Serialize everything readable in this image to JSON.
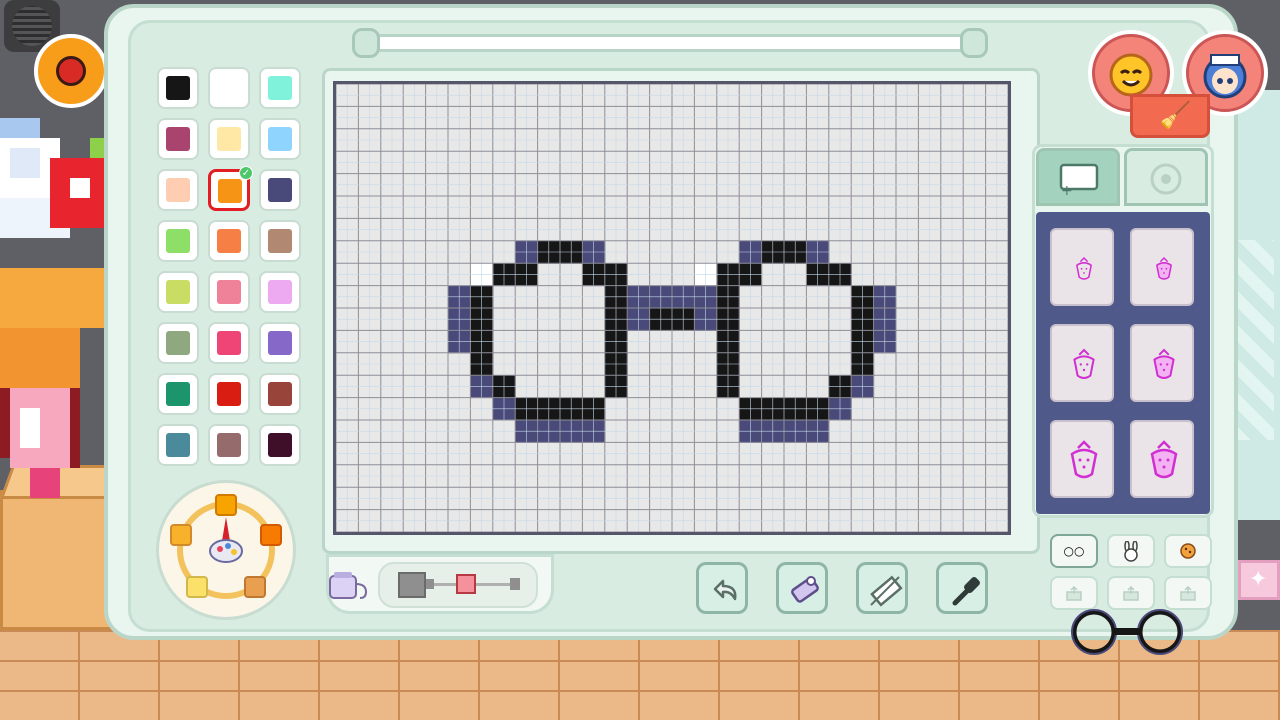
{
  "palette": {
    "colors": [
      "#161616",
      "#ffffff",
      "#80f2dc",
      "#a9446e",
      "#ffe8a6",
      "#8fd3ff",
      "#ffcdb2",
      "#f59415",
      "#49497a",
      "#8edf68",
      "#f57f45",
      "#b18872",
      "#c9dc63",
      "#ef8199",
      "#edaaf0",
      "#90a87f",
      "#ef4476",
      "#8568c8",
      "#1c946c",
      "#d91d12",
      "#98443a",
      "#4a8a9a",
      "#956b6b",
      "#3f0f29"
    ],
    "selected_index": 7
  },
  "colors": {
    "outline_dark": "#161616",
    "outline_shade": "#49497a",
    "canvas_bg": "#e8e8e8",
    "grid_minor": "#c5d8e8",
    "grid_major": "#8e8e98",
    "accent_red": "#e21e25",
    "template_bg": "#4f5a8a",
    "template_icon": "#d12fd1"
  },
  "canvas": {
    "cols": 30,
    "rows": 20,
    "strokes_shade": [
      [
        8,
        7
      ],
      [
        9,
        7
      ],
      [
        10,
        7
      ],
      [
        11,
        7
      ],
      [
        18,
        7
      ],
      [
        19,
        7
      ],
      [
        20,
        7
      ],
      [
        21,
        7
      ],
      [
        5,
        9
      ],
      [
        24,
        9
      ],
      [
        5,
        10
      ],
      [
        24,
        10
      ],
      [
        5,
        11
      ],
      [
        24,
        11
      ],
      [
        6,
        13
      ],
      [
        23,
        13
      ],
      [
        7,
        14
      ],
      [
        22,
        14
      ],
      [
        8,
        15
      ],
      [
        9,
        15
      ],
      [
        10,
        15
      ],
      [
        11,
        15
      ],
      [
        18,
        15
      ],
      [
        19,
        15
      ],
      [
        20,
        15
      ],
      [
        21,
        15
      ],
      [
        13,
        9
      ],
      [
        16,
        9
      ],
      [
        13,
        10
      ],
      [
        16,
        10
      ]
    ],
    "strokes_dark": [
      [
        7,
        8
      ],
      [
        8,
        8
      ],
      [
        11,
        8
      ],
      [
        12,
        8
      ],
      [
        17,
        8
      ],
      [
        18,
        8
      ],
      [
        21,
        8
      ],
      [
        22,
        8
      ],
      [
        6,
        9
      ],
      [
        12,
        9
      ],
      [
        17,
        9
      ],
      [
        23,
        9
      ],
      [
        6,
        10
      ],
      [
        12,
        10
      ],
      [
        17,
        10
      ],
      [
        23,
        10
      ],
      [
        6,
        11
      ],
      [
        12,
        11
      ],
      [
        17,
        11
      ],
      [
        23,
        11
      ],
      [
        6,
        12
      ],
      [
        12,
        12
      ],
      [
        17,
        12
      ],
      [
        23,
        12
      ],
      [
        7,
        13
      ],
      [
        12,
        13
      ],
      [
        17,
        13
      ],
      [
        22,
        13
      ],
      [
        8,
        14
      ],
      [
        9,
        14
      ],
      [
        10,
        14
      ],
      [
        11,
        14
      ],
      [
        18,
        14
      ],
      [
        19,
        14
      ],
      [
        20,
        14
      ],
      [
        21,
        14
      ],
      [
        14,
        10
      ],
      [
        15,
        10
      ],
      [
        9,
        7
      ],
      [
        10,
        7
      ],
      [
        19,
        7
      ],
      [
        20,
        7
      ]
    ],
    "strokes_white": [
      [
        6,
        8
      ],
      [
        16,
        8
      ]
    ],
    "strokes_extra_shade": [
      [
        13,
        10
      ],
      [
        16,
        10
      ],
      [
        14,
        9
      ],
      [
        15,
        9
      ]
    ]
  },
  "templates": {
    "grid": [
      "strawberry-small-icon",
      "strawberry-medium-icon",
      "strawberry-outline-icon",
      "strawberry-3d-icon",
      "strawberry-large-icon",
      "strawberry-large-3d-icon"
    ]
  },
  "presets": {
    "slots": [
      "glasses",
      "bunny",
      "cookie",
      "empty",
      "empty",
      "empty"
    ],
    "glasses_label": "○○"
  },
  "tools": [
    "undo-icon",
    "eraser-icon",
    "clear-icon",
    "eyedropper-icon"
  ]
}
